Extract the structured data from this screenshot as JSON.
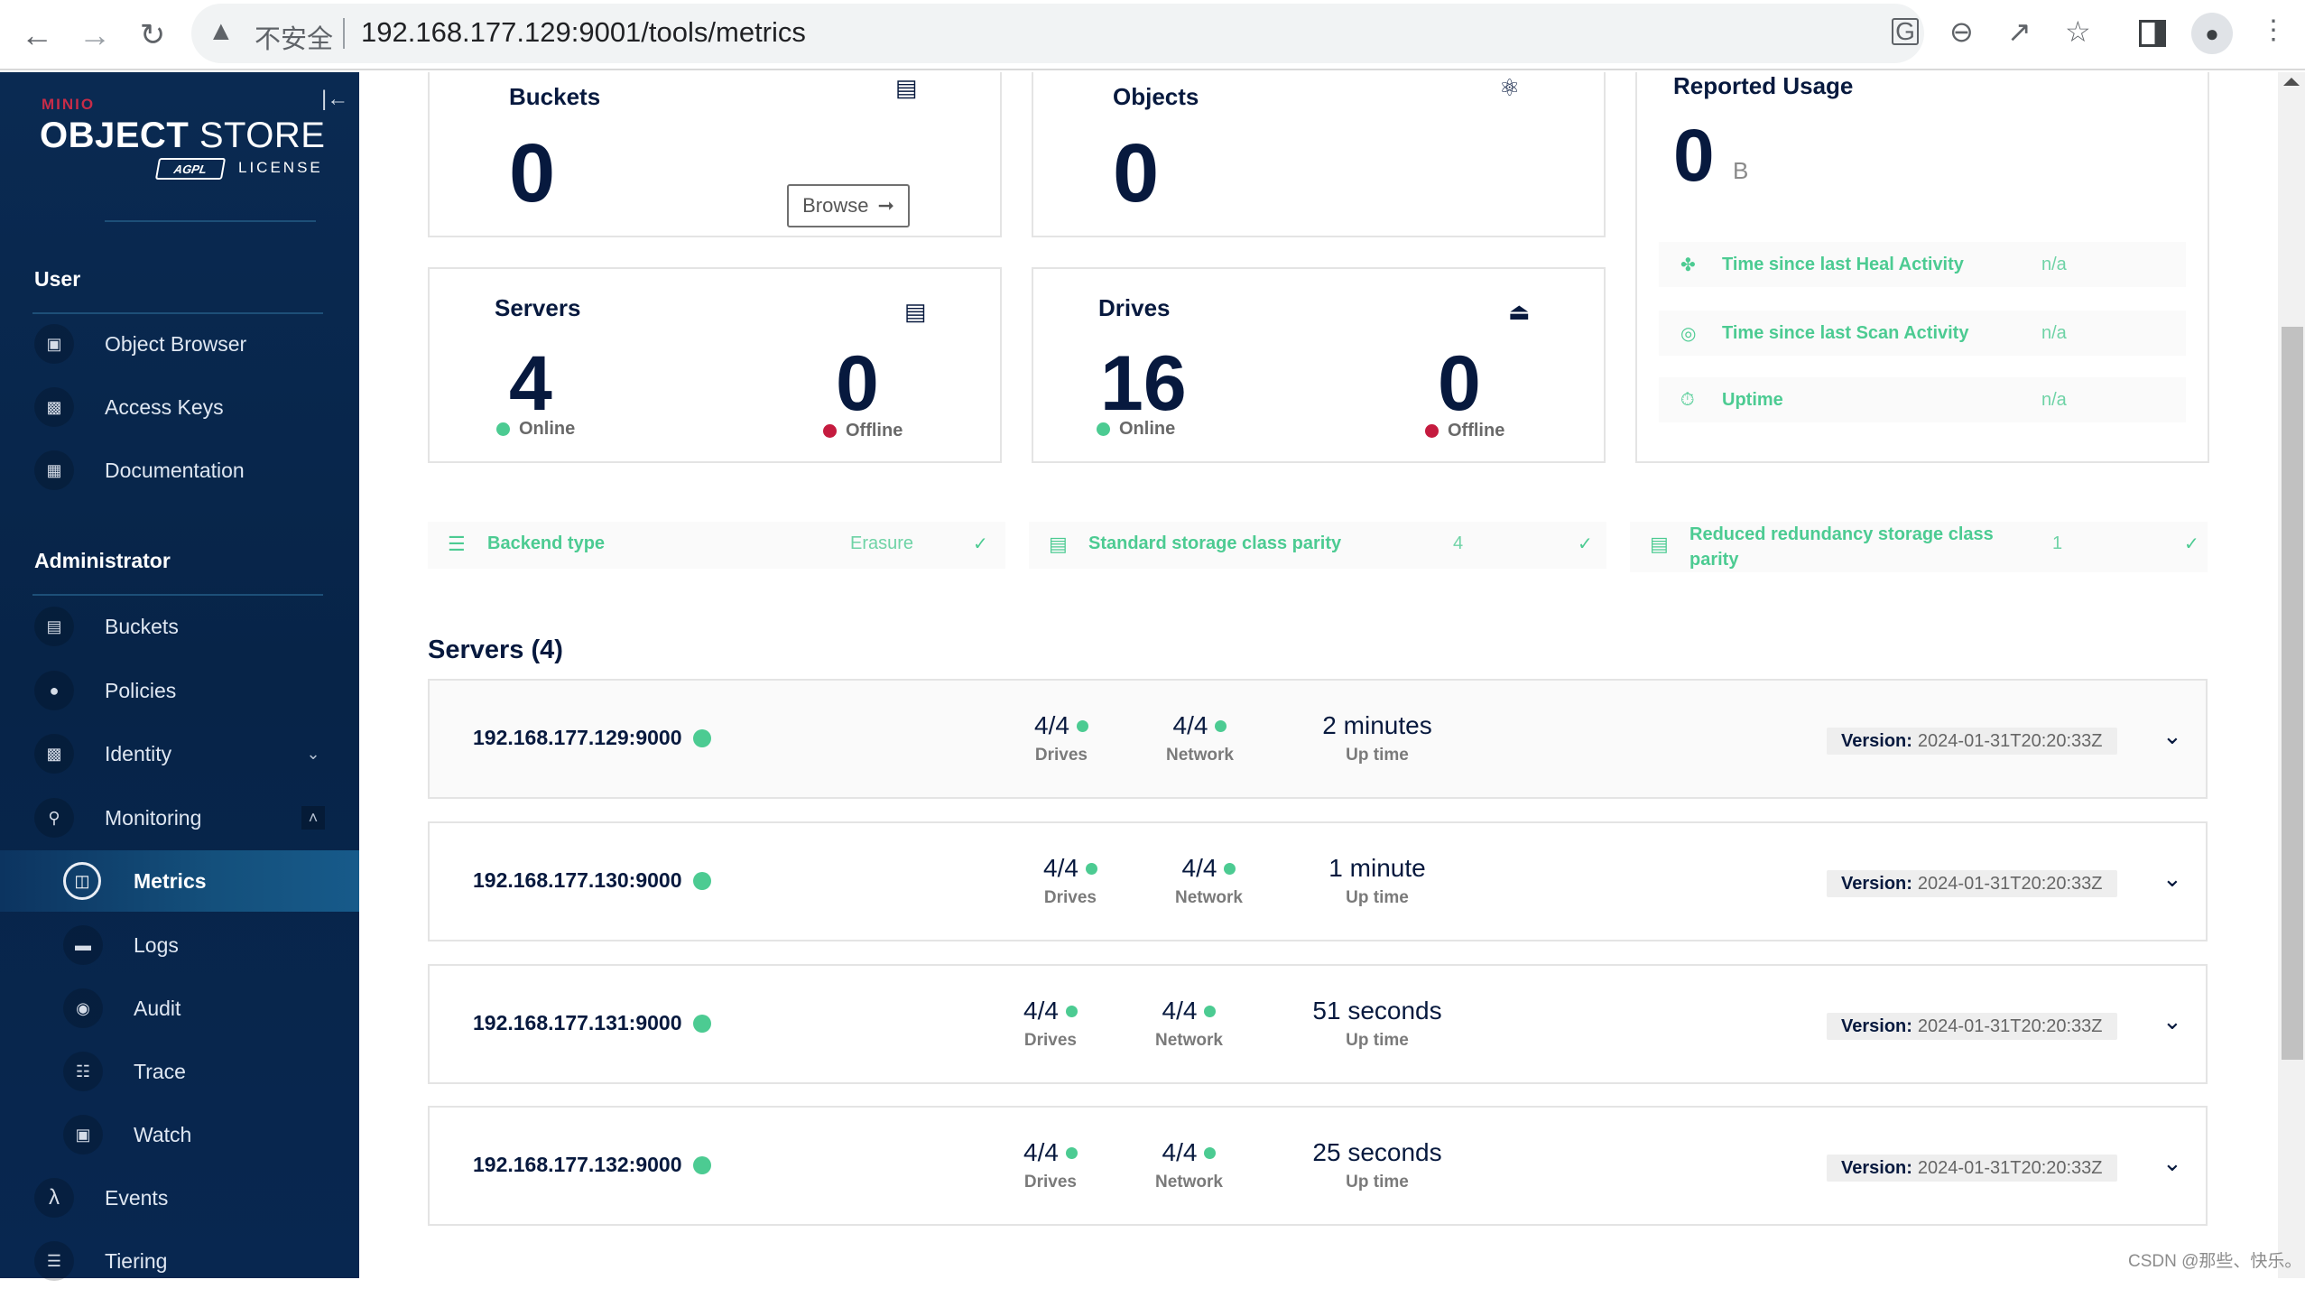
{
  "browser": {
    "security_label": "不安全",
    "url": "192.168.177.129:9001/tools/metrics",
    "icons": [
      "back-icon",
      "forward-icon",
      "reload-icon",
      "warning-icon",
      "translate-icon",
      "zoom-out-icon",
      "share-icon",
      "star-icon",
      "side-panel-icon",
      "profile-icon",
      "menu-icon"
    ]
  },
  "sidebar": {
    "logo": {
      "brand": "MINIO",
      "title_bold": "OBJECT",
      "title_light": " STORE",
      "badge": "AGPL",
      "license": "LICENSE"
    },
    "sections": [
      {
        "label": "User"
      },
      {
        "label": "Administrator"
      }
    ],
    "user_items": [
      {
        "label": "Object Browser",
        "icon": "object-browser-icon"
      },
      {
        "label": "Access Keys",
        "icon": "access-keys-icon"
      },
      {
        "label": "Documentation",
        "icon": "documentation-icon"
      }
    ],
    "admin_items": [
      {
        "label": "Buckets",
        "icon": "buckets-icon"
      },
      {
        "label": "Policies",
        "icon": "policies-icon"
      },
      {
        "label": "Identity",
        "icon": "identity-icon",
        "expandable": true
      },
      {
        "label": "Monitoring",
        "icon": "monitoring-icon",
        "expanded": true
      }
    ],
    "monitoring_items": [
      {
        "label": "Metrics",
        "icon": "metrics-icon",
        "active": true
      },
      {
        "label": "Logs",
        "icon": "logs-icon"
      },
      {
        "label": "Audit",
        "icon": "audit-icon"
      },
      {
        "label": "Trace",
        "icon": "trace-icon"
      },
      {
        "label": "Watch",
        "icon": "watch-icon"
      }
    ],
    "bottom_items": [
      {
        "label": "Events",
        "icon": "lambda-icon"
      },
      {
        "label": "Tiering",
        "icon": "tiering-icon"
      }
    ]
  },
  "summary": {
    "buckets": {
      "title": "Buckets",
      "value": "0",
      "browse_label": "Browse"
    },
    "objects": {
      "title": "Objects",
      "value": "0"
    },
    "servers": {
      "title": "Servers",
      "online": "4",
      "offline": "0",
      "online_label": "Online",
      "offline_label": "Offline"
    },
    "drives": {
      "title": "Drives",
      "online": "16",
      "offline": "0",
      "online_label": "Online",
      "offline_label": "Offline"
    },
    "usage": {
      "title": "Reported Usage",
      "value": "0",
      "unit": "B",
      "rows": [
        {
          "label": "Time since last Heal Activity",
          "value": "n/a",
          "icon": "heal-icon"
        },
        {
          "label": "Time since last Scan Activity",
          "value": "n/a",
          "icon": "scan-icon"
        },
        {
          "label": "Uptime",
          "value": "n/a",
          "icon": "uptime-icon"
        }
      ]
    }
  },
  "info": [
    {
      "label": "Backend type",
      "value": "Erasure",
      "icon": "backend-icon"
    },
    {
      "label": "Standard storage class parity",
      "value": "4",
      "icon": "storage-class-icon"
    },
    {
      "label": "Reduced redundancy storage class parity",
      "label_line1": "Reduced redundancy storage class",
      "label_line2": "parity",
      "value": "1",
      "icon": "storage-class-icon"
    }
  ],
  "servers_section": {
    "title": "Servers (4)",
    "drives_label": "Drives",
    "network_label": "Network",
    "uptime_label": "Up time",
    "version_label": "Version:",
    "rows": [
      {
        "host": "192.168.177.129:9000",
        "drives": "4/4",
        "network": "4/4",
        "uptime": "2 minutes",
        "version": "2024-01-31T20:20:33Z"
      },
      {
        "host": "192.168.177.130:9000",
        "drives": "4/4",
        "network": "4/4",
        "uptime": "1 minute",
        "version": "2024-01-31T20:20:33Z"
      },
      {
        "host": "192.168.177.131:9000",
        "drives": "4/4",
        "network": "4/4",
        "uptime": "51 seconds",
        "version": "2024-01-31T20:20:33Z"
      },
      {
        "host": "192.168.177.132:9000",
        "drives": "4/4",
        "network": "4/4",
        "uptime": "25 seconds",
        "version": "2024-01-31T20:20:33Z"
      }
    ]
  },
  "colors": {
    "sidebar_bg": "#0a2a52",
    "navy_text": "#07193e",
    "accent_green": "#4ccb92",
    "offline_red": "#c51b3f",
    "brand_red": "#c72c48"
  },
  "watermark": "CSDN @那些、快乐。"
}
